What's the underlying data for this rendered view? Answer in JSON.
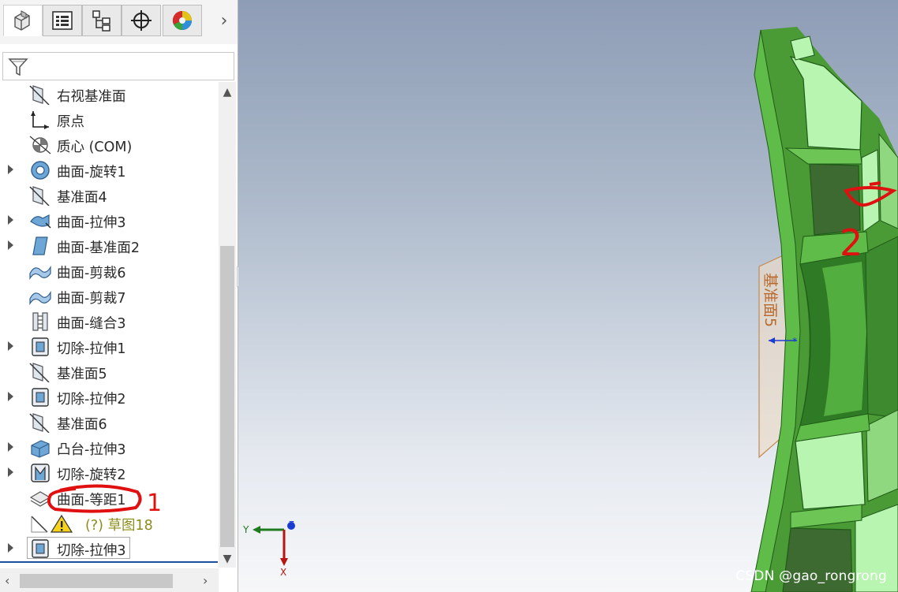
{
  "tabs": [
    {
      "id": "feature-manager",
      "icon": "feature-manager-icon",
      "active": true
    },
    {
      "id": "property-manager",
      "icon": "property-manager-icon",
      "active": false
    },
    {
      "id": "configuration-manager",
      "icon": "configuration-manager-icon",
      "active": false
    },
    {
      "id": "dimxpert-manager",
      "icon": "crosshair-icon",
      "active": false
    },
    {
      "id": "display-manager",
      "icon": "display-manager-icon",
      "active": false
    }
  ],
  "tab_more_glyph": "›",
  "filter": {
    "icon": "filter-icon",
    "placeholder": ""
  },
  "tree": [
    {
      "label": "右视基准面",
      "icon": "plane-icon",
      "expandable": false
    },
    {
      "label": "原点",
      "icon": "origin-icon",
      "expandable": false
    },
    {
      "label": "质心 (COM)",
      "icon": "center-of-mass-icon",
      "expandable": false
    },
    {
      "label": "曲面-旋转1",
      "icon": "surface-revolve-icon",
      "expandable": true
    },
    {
      "label": "基准面4",
      "icon": "plane-icon",
      "expandable": false
    },
    {
      "label": "曲面-拉伸3",
      "icon": "surface-extrude-icon",
      "expandable": true
    },
    {
      "label": "曲面-基准面2",
      "icon": "planar-surface-icon",
      "expandable": true
    },
    {
      "label": "曲面-剪裁6",
      "icon": "surface-trim-icon",
      "expandable": false
    },
    {
      "label": "曲面-剪裁7",
      "icon": "surface-trim-icon",
      "expandable": false
    },
    {
      "label": "曲面-缝合3",
      "icon": "surface-knit-icon",
      "expandable": false
    },
    {
      "label": "切除-拉伸1",
      "icon": "cut-extrude-icon",
      "expandable": true
    },
    {
      "label": "基准面5",
      "icon": "plane-icon",
      "expandable": false
    },
    {
      "label": "切除-拉伸2",
      "icon": "cut-extrude-icon",
      "expandable": true
    },
    {
      "label": "基准面6",
      "icon": "plane-icon",
      "expandable": false
    },
    {
      "label": "凸台-拉伸3",
      "icon": "boss-extrude-icon",
      "expandable": true
    },
    {
      "label": "切除-旋转2",
      "icon": "cut-revolve-icon",
      "expandable": true
    },
    {
      "label": "曲面-等距1",
      "icon": "surface-offset-icon",
      "expandable": false
    },
    {
      "label": "(?) 草图18",
      "icon": "sketch-icon",
      "expandable": false,
      "warning": true
    },
    {
      "label": "切除-拉伸3",
      "icon": "cut-extrude-icon",
      "expandable": true,
      "selected": true
    }
  ],
  "viewport": {
    "plane_label": "基准面5",
    "triad": {
      "x": "X",
      "y": "Y",
      "z": "Z"
    },
    "watermark": "CSDN @gao_rongrong",
    "annotations": [
      "1",
      "2"
    ],
    "colors": {
      "body_dark": "#3a8a2a",
      "body_light": "#b8f5b0",
      "body_edge": "#1f5a18",
      "plane": "#c48a52",
      "annotation": "#e01010"
    }
  }
}
